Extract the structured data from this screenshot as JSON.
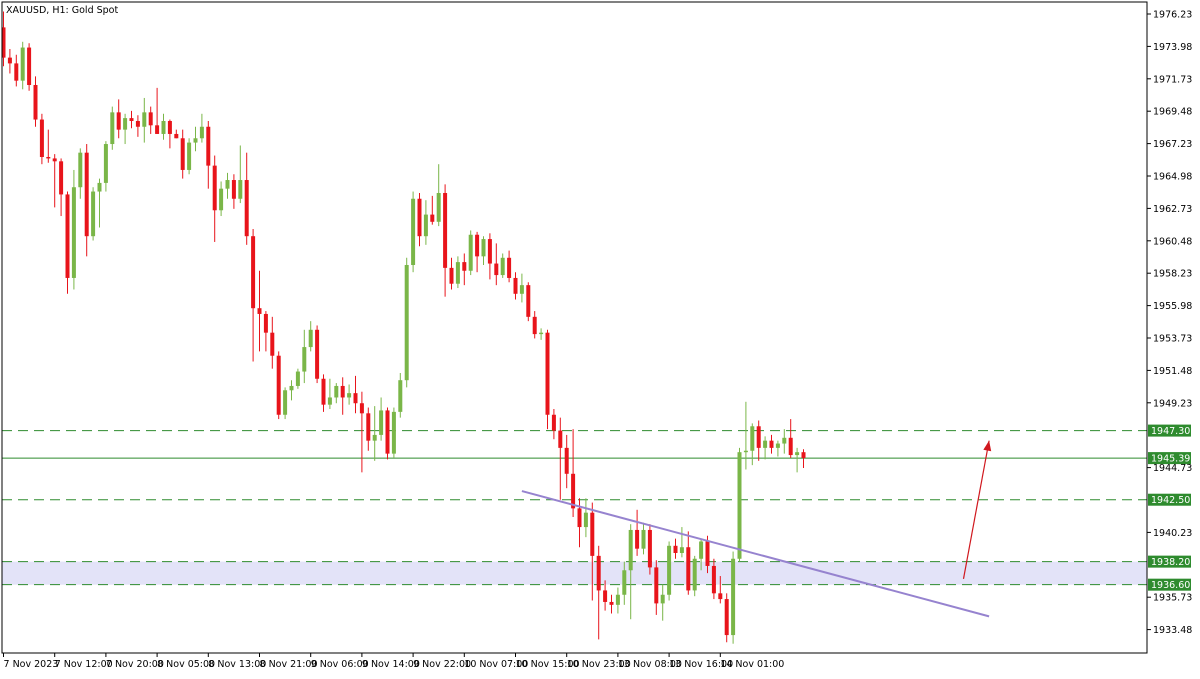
{
  "header": {
    "symbol": "XAUUSD",
    "timeframe": "H1",
    "description": "Gold Spot"
  },
  "colors": {
    "bull": "#7ab648",
    "bear": "#e8141b",
    "level_line": "#2e8b2e",
    "trendline": "#9683cf",
    "arrow": "#d0181e",
    "zone": "#e3e3f8",
    "tag_bg": "#2e8b2e"
  },
  "chart_data": {
    "type": "candlestick",
    "symbol": "XAUUSD, H1: Gold Spot",
    "y_axis": {
      "ylim": [
        1931.0,
        1977.0
      ],
      "ticks": [
        "1976.23",
        "1973.98",
        "1971.73",
        "1969.48",
        "1967.23",
        "1964.98",
        "1962.73",
        "1960.48",
        "1958.23",
        "1955.98",
        "1953.73",
        "1951.48",
        "1949.23",
        "1944.73",
        "1940.23",
        "1935.73",
        "1933.48"
      ]
    },
    "x_axis": {
      "ticks": [
        {
          "label": "7 Nov 2023",
          "index": 0
        },
        {
          "label": "7 Nov 12:00",
          "index": 8
        },
        {
          "label": "7 Nov 20:00",
          "index": 16
        },
        {
          "label": "8 Nov 05:00",
          "index": 24
        },
        {
          "label": "8 Nov 13:00",
          "index": 32
        },
        {
          "label": "8 Nov 21:00",
          "index": 40
        },
        {
          "label": "9 Nov 06:00",
          "index": 48
        },
        {
          "label": "9 Nov 14:00",
          "index": 56
        },
        {
          "label": "9 Nov 22:00",
          "index": 64
        },
        {
          "label": "10 Nov 07:00",
          "index": 72
        },
        {
          "label": "10 Nov 15:00",
          "index": 80
        },
        {
          "label": "10 Nov 23:00",
          "index": 88
        },
        {
          "label": "13 Nov 08:00",
          "index": 96
        },
        {
          "label": "13 Nov 16:00",
          "index": 104
        },
        {
          "label": "14 Nov 01:00",
          "index": 112
        }
      ]
    },
    "candles": [
      {
        "o": 1975.3,
        "h": 1976.4,
        "l": 1972.6,
        "c": 1973.2
      },
      {
        "o": 1973.2,
        "h": 1973.8,
        "l": 1972.1,
        "c": 1972.8
      },
      {
        "o": 1972.8,
        "h": 1973.4,
        "l": 1971.2,
        "c": 1971.6
      },
      {
        "o": 1971.6,
        "h": 1974.3,
        "l": 1971.0,
        "c": 1973.9
      },
      {
        "o": 1973.9,
        "h": 1974.2,
        "l": 1970.9,
        "c": 1971.3
      },
      {
        "o": 1971.3,
        "h": 1971.9,
        "l": 1968.4,
        "c": 1968.9
      },
      {
        "o": 1968.9,
        "h": 1969.3,
        "l": 1965.8,
        "c": 1966.3
      },
      {
        "o": 1966.3,
        "h": 1968.2,
        "l": 1965.9,
        "c": 1966.2
      },
      {
        "o": 1966.2,
        "h": 1966.5,
        "l": 1962.8,
        "c": 1966.0
      },
      {
        "o": 1966.0,
        "h": 1966.2,
        "l": 1962.2,
        "c": 1963.7
      },
      {
        "o": 1963.7,
        "h": 1963.9,
        "l": 1956.8,
        "c": 1957.9
      },
      {
        "o": 1957.9,
        "h": 1965.4,
        "l": 1957.1,
        "c": 1964.2
      },
      {
        "o": 1964.2,
        "h": 1966.9,
        "l": 1963.4,
        "c": 1966.6
      },
      {
        "o": 1966.6,
        "h": 1967.2,
        "l": 1959.4,
        "c": 1960.8
      },
      {
        "o": 1960.8,
        "h": 1964.2,
        "l": 1960.5,
        "c": 1963.9
      },
      {
        "o": 1963.9,
        "h": 1964.8,
        "l": 1961.4,
        "c": 1964.5
      },
      {
        "o": 1964.5,
        "h": 1967.4,
        "l": 1963.9,
        "c": 1967.2
      },
      {
        "o": 1967.2,
        "h": 1969.8,
        "l": 1966.8,
        "c": 1969.4
      },
      {
        "o": 1969.4,
        "h": 1970.3,
        "l": 1967.6,
        "c": 1968.2
      },
      {
        "o": 1968.2,
        "h": 1969.3,
        "l": 1967.2,
        "c": 1969.0
      },
      {
        "o": 1969.0,
        "h": 1969.5,
        "l": 1968.3,
        "c": 1968.8
      },
      {
        "o": 1968.8,
        "h": 1969.2,
        "l": 1967.7,
        "c": 1968.4
      },
      {
        "o": 1968.4,
        "h": 1970.4,
        "l": 1967.3,
        "c": 1969.4
      },
      {
        "o": 1969.4,
        "h": 1969.8,
        "l": 1967.9,
        "c": 1968.5
      },
      {
        "o": 1968.5,
        "h": 1971.1,
        "l": 1967.9,
        "c": 1967.9
      },
      {
        "o": 1967.9,
        "h": 1969.3,
        "l": 1967.5,
        "c": 1968.8
      },
      {
        "o": 1968.8,
        "h": 1968.9,
        "l": 1966.9,
        "c": 1967.9
      },
      {
        "o": 1967.9,
        "h": 1968.2,
        "l": 1967.6,
        "c": 1967.6
      },
      {
        "o": 1967.6,
        "h": 1968.2,
        "l": 1964.8,
        "c": 1965.4
      },
      {
        "o": 1965.4,
        "h": 1967.6,
        "l": 1965.1,
        "c": 1967.3
      },
      {
        "o": 1967.3,
        "h": 1968.4,
        "l": 1966.7,
        "c": 1967.6
      },
      {
        "o": 1967.6,
        "h": 1969.3,
        "l": 1967.3,
        "c": 1968.4
      },
      {
        "o": 1968.4,
        "h": 1968.8,
        "l": 1964.1,
        "c": 1965.7
      },
      {
        "o": 1965.7,
        "h": 1966.4,
        "l": 1960.4,
        "c": 1962.6
      },
      {
        "o": 1962.6,
        "h": 1964.6,
        "l": 1962.2,
        "c": 1964.1
      },
      {
        "o": 1964.1,
        "h": 1965.2,
        "l": 1963.4,
        "c": 1964.7
      },
      {
        "o": 1964.7,
        "h": 1965.1,
        "l": 1962.7,
        "c": 1963.4
      },
      {
        "o": 1963.4,
        "h": 1967.1,
        "l": 1963.1,
        "c": 1964.7
      },
      {
        "o": 1964.7,
        "h": 1966.6,
        "l": 1960.2,
        "c": 1960.8
      },
      {
        "o": 1960.8,
        "h": 1961.3,
        "l": 1952.1,
        "c": 1955.8
      },
      {
        "o": 1955.8,
        "h": 1958.4,
        "l": 1952.8,
        "c": 1955.4
      },
      {
        "o": 1955.4,
        "h": 1955.6,
        "l": 1952.8,
        "c": 1954.1
      },
      {
        "o": 1954.1,
        "h": 1955.2,
        "l": 1951.6,
        "c": 1952.5
      },
      {
        "o": 1952.5,
        "h": 1952.8,
        "l": 1948.1,
        "c": 1948.4
      },
      {
        "o": 1948.4,
        "h": 1950.3,
        "l": 1948.1,
        "c": 1950.1
      },
      {
        "o": 1950.1,
        "h": 1950.8,
        "l": 1949.4,
        "c": 1950.4
      },
      {
        "o": 1950.4,
        "h": 1951.6,
        "l": 1950.2,
        "c": 1951.4
      },
      {
        "o": 1951.4,
        "h": 1954.3,
        "l": 1950.6,
        "c": 1953.1
      },
      {
        "o": 1953.1,
        "h": 1954.9,
        "l": 1952.8,
        "c": 1954.3
      },
      {
        "o": 1954.3,
        "h": 1954.6,
        "l": 1950.6,
        "c": 1950.9
      },
      {
        "o": 1950.9,
        "h": 1951.2,
        "l": 1948.6,
        "c": 1949.1
      },
      {
        "o": 1949.1,
        "h": 1950.9,
        "l": 1948.8,
        "c": 1949.6
      },
      {
        "o": 1949.6,
        "h": 1950.6,
        "l": 1949.2,
        "c": 1950.4
      },
      {
        "o": 1950.4,
        "h": 1951.0,
        "l": 1948.4,
        "c": 1949.6
      },
      {
        "o": 1949.6,
        "h": 1950.5,
        "l": 1949.1,
        "c": 1949.9
      },
      {
        "o": 1949.9,
        "h": 1951.1,
        "l": 1948.5,
        "c": 1949.2
      },
      {
        "o": 1949.2,
        "h": 1950.0,
        "l": 1944.4,
        "c": 1948.5
      },
      {
        "o": 1948.5,
        "h": 1948.9,
        "l": 1945.9,
        "c": 1946.6
      },
      {
        "o": 1946.6,
        "h": 1949.0,
        "l": 1945.2,
        "c": 1947.0
      },
      {
        "o": 1947.0,
        "h": 1949.6,
        "l": 1946.6,
        "c": 1948.7
      },
      {
        "o": 1948.7,
        "h": 1948.9,
        "l": 1945.3,
        "c": 1945.7
      },
      {
        "o": 1945.7,
        "h": 1948.9,
        "l": 1945.4,
        "c": 1948.6
      },
      {
        "o": 1948.6,
        "h": 1951.3,
        "l": 1948.2,
        "c": 1950.8
      },
      {
        "o": 1950.8,
        "h": 1959.3,
        "l": 1950.3,
        "c": 1958.8
      },
      {
        "o": 1958.8,
        "h": 1963.9,
        "l": 1958.3,
        "c": 1963.4
      },
      {
        "o": 1963.4,
        "h": 1963.8,
        "l": 1960.1,
        "c": 1960.8
      },
      {
        "o": 1960.8,
        "h": 1963.3,
        "l": 1960.2,
        "c": 1962.3
      },
      {
        "o": 1962.3,
        "h": 1963.6,
        "l": 1961.6,
        "c": 1961.8
      },
      {
        "o": 1961.8,
        "h": 1965.8,
        "l": 1961.5,
        "c": 1963.8
      },
      {
        "o": 1963.8,
        "h": 1964.4,
        "l": 1956.6,
        "c": 1958.6
      },
      {
        "o": 1958.6,
        "h": 1959.3,
        "l": 1957.1,
        "c": 1957.5
      },
      {
        "o": 1957.5,
        "h": 1959.4,
        "l": 1957.2,
        "c": 1959.0
      },
      {
        "o": 1959.0,
        "h": 1959.6,
        "l": 1957.4,
        "c": 1958.4
      },
      {
        "o": 1958.4,
        "h": 1961.2,
        "l": 1958.1,
        "c": 1960.9
      },
      {
        "o": 1960.9,
        "h": 1961.1,
        "l": 1958.3,
        "c": 1959.4
      },
      {
        "o": 1959.4,
        "h": 1960.8,
        "l": 1958.8,
        "c": 1960.6
      },
      {
        "o": 1960.6,
        "h": 1961.0,
        "l": 1957.8,
        "c": 1958.9
      },
      {
        "o": 1958.9,
        "h": 1960.3,
        "l": 1957.4,
        "c": 1958.1
      },
      {
        "o": 1958.1,
        "h": 1959.6,
        "l": 1957.9,
        "c": 1959.3
      },
      {
        "o": 1959.3,
        "h": 1959.8,
        "l": 1957.6,
        "c": 1957.9
      },
      {
        "o": 1957.9,
        "h": 1958.3,
        "l": 1956.4,
        "c": 1956.8
      },
      {
        "o": 1956.8,
        "h": 1958.2,
        "l": 1956.2,
        "c": 1957.4
      },
      {
        "o": 1957.4,
        "h": 1957.6,
        "l": 1954.9,
        "c": 1955.2
      },
      {
        "o": 1955.2,
        "h": 1955.6,
        "l": 1953.7,
        "c": 1954.0
      },
      {
        "o": 1954.0,
        "h": 1954.4,
        "l": 1953.6,
        "c": 1954.1
      },
      {
        "o": 1954.1,
        "h": 1954.3,
        "l": 1947.4,
        "c": 1948.4
      },
      {
        "o": 1948.4,
        "h": 1948.8,
        "l": 1946.7,
        "c": 1947.3
      },
      {
        "o": 1947.3,
        "h": 1948.2,
        "l": 1942.5,
        "c": 1946.1
      },
      {
        "o": 1946.1,
        "h": 1947.0,
        "l": 1943.3,
        "c": 1944.3
      },
      {
        "o": 1944.3,
        "h": 1947.4,
        "l": 1941.3,
        "c": 1941.9
      },
      {
        "o": 1941.9,
        "h": 1942.6,
        "l": 1939.2,
        "c": 1940.6
      },
      {
        "o": 1940.6,
        "h": 1942.6,
        "l": 1939.9,
        "c": 1941.6
      },
      {
        "o": 1941.6,
        "h": 1942.3,
        "l": 1935.5,
        "c": 1938.6
      },
      {
        "o": 1938.6,
        "h": 1939.3,
        "l": 1932.8,
        "c": 1936.2
      },
      {
        "o": 1936.2,
        "h": 1936.9,
        "l": 1934.8,
        "c": 1935.4
      },
      {
        "o": 1935.4,
        "h": 1935.9,
        "l": 1934.6,
        "c": 1935.2
      },
      {
        "o": 1935.2,
        "h": 1936.4,
        "l": 1934.6,
        "c": 1935.9
      },
      {
        "o": 1935.9,
        "h": 1938.2,
        "l": 1935.2,
        "c": 1937.6
      },
      {
        "o": 1937.6,
        "h": 1940.8,
        "l": 1934.2,
        "c": 1940.4
      },
      {
        "o": 1940.4,
        "h": 1941.8,
        "l": 1938.6,
        "c": 1939.1
      },
      {
        "o": 1939.1,
        "h": 1940.9,
        "l": 1938.7,
        "c": 1940.4
      },
      {
        "o": 1940.4,
        "h": 1940.8,
        "l": 1937.3,
        "c": 1937.8
      },
      {
        "o": 1937.8,
        "h": 1938.3,
        "l": 1934.5,
        "c": 1935.3
      },
      {
        "o": 1935.3,
        "h": 1936.6,
        "l": 1934.1,
        "c": 1935.9
      },
      {
        "o": 1935.9,
        "h": 1939.6,
        "l": 1935.5,
        "c": 1939.3
      },
      {
        "o": 1939.3,
        "h": 1939.8,
        "l": 1938.4,
        "c": 1938.8
      },
      {
        "o": 1938.8,
        "h": 1940.6,
        "l": 1938.5,
        "c": 1939.2
      },
      {
        "o": 1939.2,
        "h": 1940.3,
        "l": 1935.9,
        "c": 1936.2
      },
      {
        "o": 1936.2,
        "h": 1938.6,
        "l": 1935.8,
        "c": 1938.4
      },
      {
        "o": 1938.4,
        "h": 1939.8,
        "l": 1937.6,
        "c": 1939.6
      },
      {
        "o": 1939.6,
        "h": 1940.0,
        "l": 1937.4,
        "c": 1937.9
      },
      {
        "o": 1937.9,
        "h": 1938.4,
        "l": 1935.6,
        "c": 1936.0
      },
      {
        "o": 1936.0,
        "h": 1937.2,
        "l": 1935.3,
        "c": 1935.6
      },
      {
        "o": 1935.6,
        "h": 1936.0,
        "l": 1932.6,
        "c": 1933.1
      },
      {
        "o": 1933.1,
        "h": 1938.9,
        "l": 1932.5,
        "c": 1938.4
      },
      {
        "o": 1938.4,
        "h": 1946.1,
        "l": 1938.2,
        "c": 1945.8
      },
      {
        "o": 1945.8,
        "h": 1949.3,
        "l": 1944.6,
        "c": 1945.9
      },
      {
        "o": 1945.9,
        "h": 1947.8,
        "l": 1944.9,
        "c": 1947.6
      },
      {
        "o": 1947.6,
        "h": 1948.0,
        "l": 1945.2,
        "c": 1946.1
      },
      {
        "o": 1946.1,
        "h": 1946.9,
        "l": 1945.3,
        "c": 1946.6
      },
      {
        "o": 1946.6,
        "h": 1947.0,
        "l": 1945.7,
        "c": 1946.1
      },
      {
        "o": 1946.1,
        "h": 1946.6,
        "l": 1945.5,
        "c": 1946.4
      },
      {
        "o": 1946.4,
        "h": 1947.4,
        "l": 1945.7,
        "c": 1946.8
      },
      {
        "o": 1946.8,
        "h": 1948.1,
        "l": 1945.4,
        "c": 1945.6
      },
      {
        "o": 1945.6,
        "h": 1946.1,
        "l": 1944.4,
        "c": 1945.8
      },
      {
        "o": 1945.8,
        "h": 1946.0,
        "l": 1944.7,
        "c": 1945.4
      }
    ],
    "levels": [
      {
        "price": 1947.3,
        "label": "1947.30",
        "style": "dashed"
      },
      {
        "price": 1945.39,
        "label": "1945.39",
        "style": "solid"
      },
      {
        "price": 1942.5,
        "label": "1942.50",
        "style": "dashed"
      },
      {
        "price": 1938.2,
        "label": "1938.20",
        "style": "dashed"
      },
      {
        "price": 1936.6,
        "label": "1936.60",
        "style": "dashed"
      }
    ],
    "zone": {
      "from": 1936.6,
      "to": 1938.2
    },
    "trendline": {
      "start": {
        "index": 81,
        "price": 1943.1
      },
      "end": {
        "index": 154,
        "price": 1934.4
      }
    },
    "arrow": {
      "start": {
        "index": 150,
        "price": 1937.0
      },
      "end": {
        "index": 154,
        "price": 1946.6
      }
    }
  }
}
